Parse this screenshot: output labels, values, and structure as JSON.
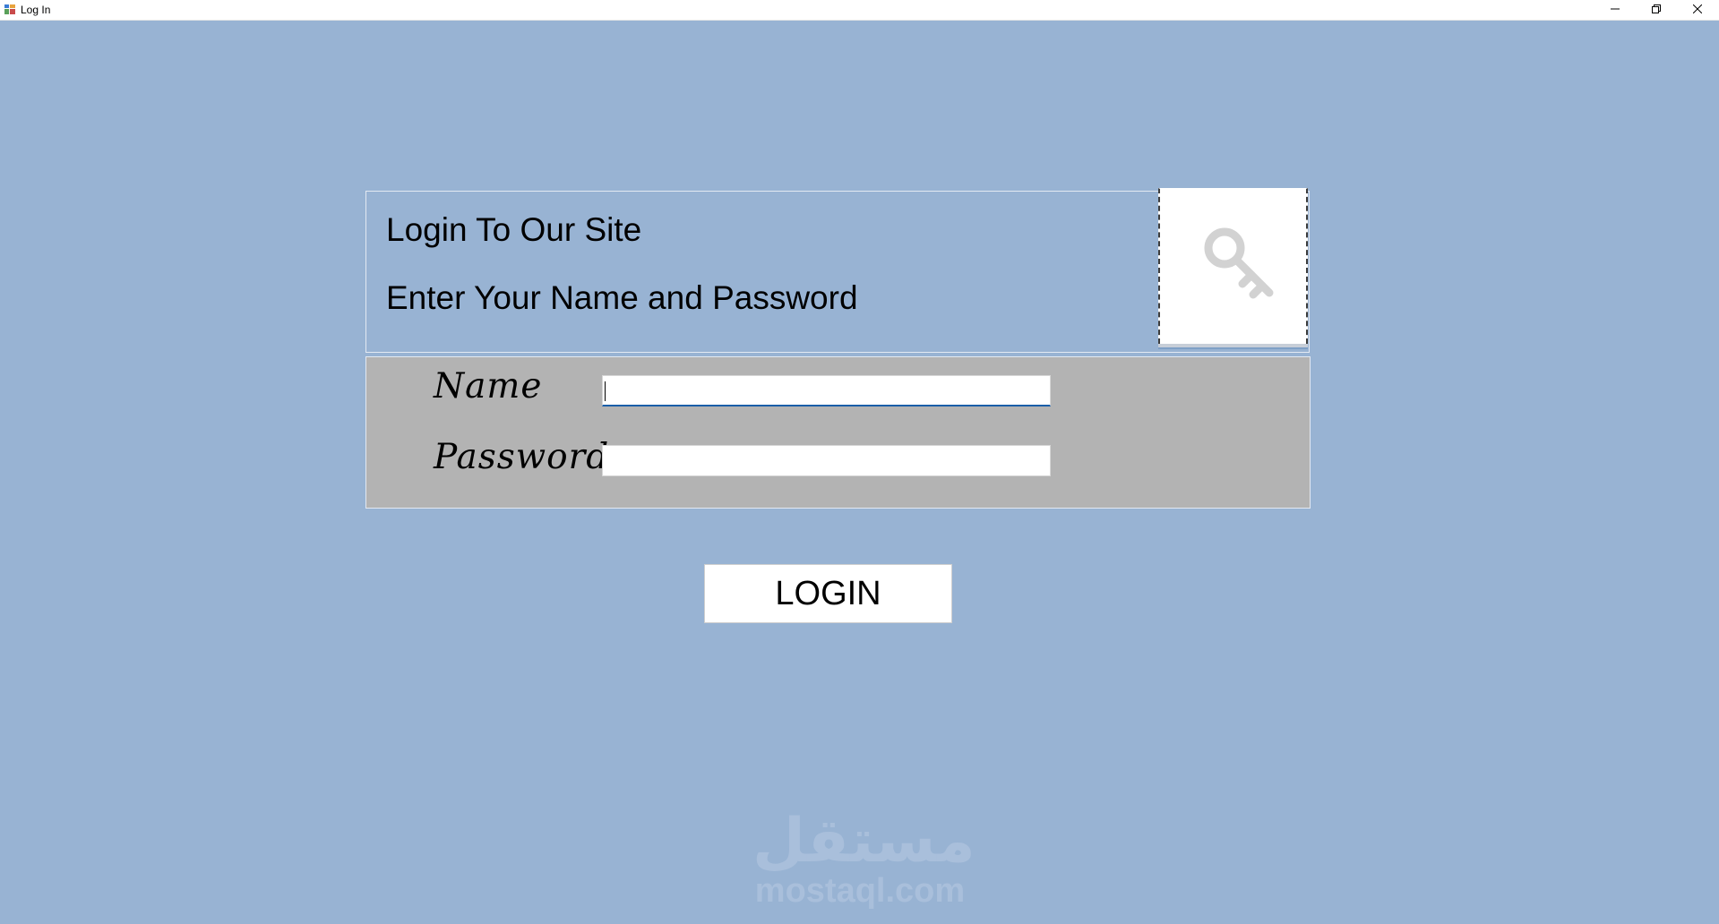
{
  "window": {
    "title": "Log In",
    "icons": {
      "app": "app-icon",
      "minimize": "minimize-icon",
      "maximize": "maximize-icon",
      "close": "close-icon"
    }
  },
  "header": {
    "title": "Login To Our Site",
    "subtitle": "Enter Your Name and Password",
    "image_icon": "key-icon"
  },
  "form": {
    "name_label": "Name",
    "name_value": "",
    "password_label": "Password",
    "password_value": ""
  },
  "login_button": {
    "label": "LOGIN"
  },
  "watermark": {
    "arabic": "مستقل",
    "latin": "mostaql.com"
  },
  "colors": {
    "background": "#98b3d3",
    "form_panel": "#b3b3b3",
    "input_focus": "#1a5ea8"
  }
}
